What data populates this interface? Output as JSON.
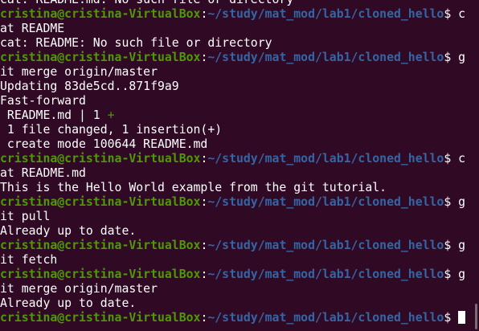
{
  "prompt": {
    "user_host": "cristina@cristina-VirtualBox",
    "colon": ":",
    "path": "~/study/mat_mod/lab1/cloned_hello",
    "symbol": "$ "
  },
  "lines": {
    "l00": "cat: README.md: No such file or directory",
    "l01": "c",
    "l02": "at README",
    "l03": "cat: README: No such file or directory",
    "l04": "g",
    "l05": "it merge origin/master",
    "l06": "Updating 83de5cd..871f9a9",
    "l07": "Fast-forward",
    "l08": " README.md | 1 ",
    "l08_plus": "+",
    "l09": " 1 file changed, 1 insertion(+)",
    "l10": " create mode 100644 README.md",
    "l11": "c",
    "l12": "at README.md",
    "l13": "This is the Hello World example from the git tutorial.",
    "l14": "g",
    "l15": "it pull",
    "l16": "Already up to date.",
    "l17": "g",
    "l18": "it fetch",
    "l19": "g",
    "l20": "it merge origin/master",
    "l21": "Already up to date."
  },
  "colors": {
    "background": "#300a24",
    "text": "#ffffff",
    "user_host": "#4e9a06",
    "path": "#3465a4"
  }
}
